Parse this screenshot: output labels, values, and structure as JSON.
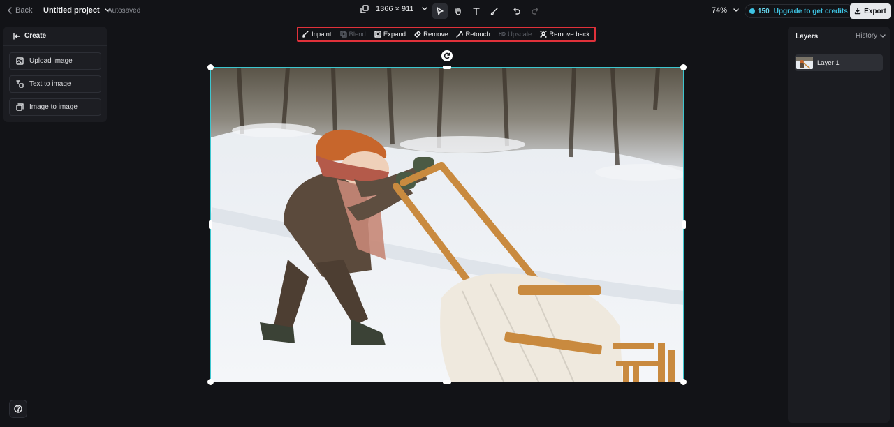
{
  "topbar": {
    "back_label": "Back",
    "project_name": "Untitled project",
    "autosave_status": "Autosaved",
    "canvas_size": "1366 × 911",
    "zoom": "74%",
    "credits": "150",
    "upgrade_label": "Upgrade to get credits",
    "export_label": "Export",
    "tools": [
      "pointer-icon",
      "hand-icon",
      "text-icon",
      "brush-icon",
      "undo-icon",
      "redo-icon"
    ]
  },
  "create_panel": {
    "title": "Create",
    "items": [
      {
        "label": "Upload image",
        "icon": "upload-image-icon"
      },
      {
        "label": "Text to image",
        "icon": "text-to-image-icon"
      },
      {
        "label": "Image to image",
        "icon": "image-to-image-icon"
      }
    ]
  },
  "ai_toolbar": {
    "items": [
      {
        "label": "Inpaint",
        "enabled": true
      },
      {
        "label": "Blend",
        "enabled": false
      },
      {
        "label": "Expand",
        "enabled": true
      },
      {
        "label": "Remove",
        "enabled": true
      },
      {
        "label": "Retouch",
        "enabled": true
      },
      {
        "label": "Upscale",
        "badge": "HD",
        "enabled": false
      },
      {
        "label": "Remove back...",
        "enabled": true
      }
    ],
    "highlight_color": "#e0313a"
  },
  "layers_panel": {
    "title": "Layers",
    "history_label": "History",
    "layers": [
      {
        "label": "Layer 1"
      }
    ]
  },
  "colors": {
    "accent": "#3ec3e3",
    "selection_border": "#3dc6cf",
    "background": "#121317"
  }
}
